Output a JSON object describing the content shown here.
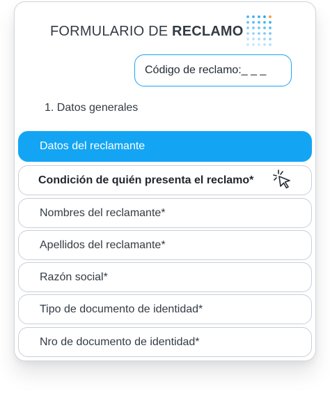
{
  "form": {
    "title_regular": "FORMULARIO DE ",
    "title_bold": "RECLAMO",
    "code_label": "Código de reclamo:_ _ _",
    "section_label": "1. Datos generales",
    "fields": [
      {
        "label": "Datos del reclamante",
        "state": "selected"
      },
      {
        "label": "Condición de quién presenta el reclamo*",
        "state": "hovered"
      },
      {
        "label": "Nombres del reclamante*",
        "state": "default"
      },
      {
        "label": "Apellidos del reclamante*",
        "state": "default"
      },
      {
        "label": "Razón social*",
        "state": "default"
      },
      {
        "label": "Tipo de documento de identidad*",
        "state": "default"
      },
      {
        "label": "Nro de documento de identidad*",
        "state": "default"
      }
    ]
  },
  "icons": {
    "decoration": "dot-grid-icon",
    "pointer": "click-cursor-icon"
  },
  "colors": {
    "accent": "#13a5f3",
    "dot_highlight": "#f59a3a",
    "text": "#333b44",
    "border": "#c9ced4"
  }
}
